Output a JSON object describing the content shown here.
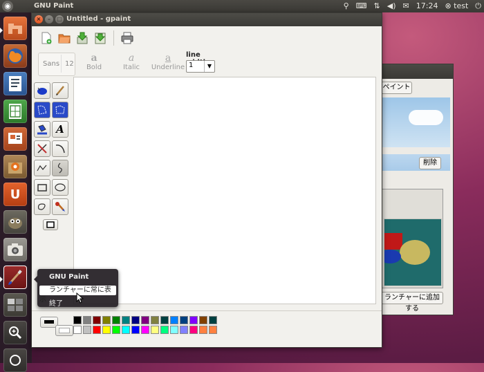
{
  "panel": {
    "app_name": "GNU Paint",
    "time": "17:24",
    "user": "test"
  },
  "launcher": {
    "items": [
      {
        "icon": "home-folder-icon"
      },
      {
        "icon": "firefox-icon"
      },
      {
        "icon": "writer-icon"
      },
      {
        "icon": "calc-icon"
      },
      {
        "icon": "impress-icon"
      },
      {
        "icon": "software-center-icon"
      },
      {
        "icon": "ubuntu-one-icon"
      },
      {
        "icon": "gimp-icon"
      },
      {
        "icon": "screenshot-icon"
      },
      {
        "icon": "gpaint-icon"
      },
      {
        "icon": "workspaces-icon"
      },
      {
        "icon": "search-icon"
      }
    ]
  },
  "window": {
    "title": "Untitled - gpaint"
  },
  "font": {
    "family": "Sans",
    "size": "12",
    "bold": "Bold",
    "italic": "Italic",
    "underline": "Underline",
    "glyph": "a"
  },
  "line_width": {
    "label": "line width",
    "value": "1"
  },
  "context_menu": {
    "title": "GNU Paint",
    "item_keep": "ランチャーに常に表示",
    "item_quit": "終了"
  },
  "bg_window": {
    "paint_button": "ペイント",
    "delete_button": "削除",
    "add_button": "ランチャーに追加する"
  },
  "palette": {
    "row1": [
      "#000000",
      "#808080",
      "#800000",
      "#808000",
      "#008000",
      "#008080",
      "#000080",
      "#800080",
      "#808040",
      "#004040",
      "#0080ff",
      "#004080",
      "#8000ff",
      "#804000",
      "#004040"
    ],
    "row2": [
      "#ffffff",
      "#c0c0c0",
      "#ff0000",
      "#ffff00",
      "#00ff00",
      "#00ffff",
      "#0000ff",
      "#ff00ff",
      "#ffff80",
      "#00ff80",
      "#80ffff",
      "#8080ff",
      "#ff0080",
      "#ff8040",
      "#ff8040"
    ]
  }
}
